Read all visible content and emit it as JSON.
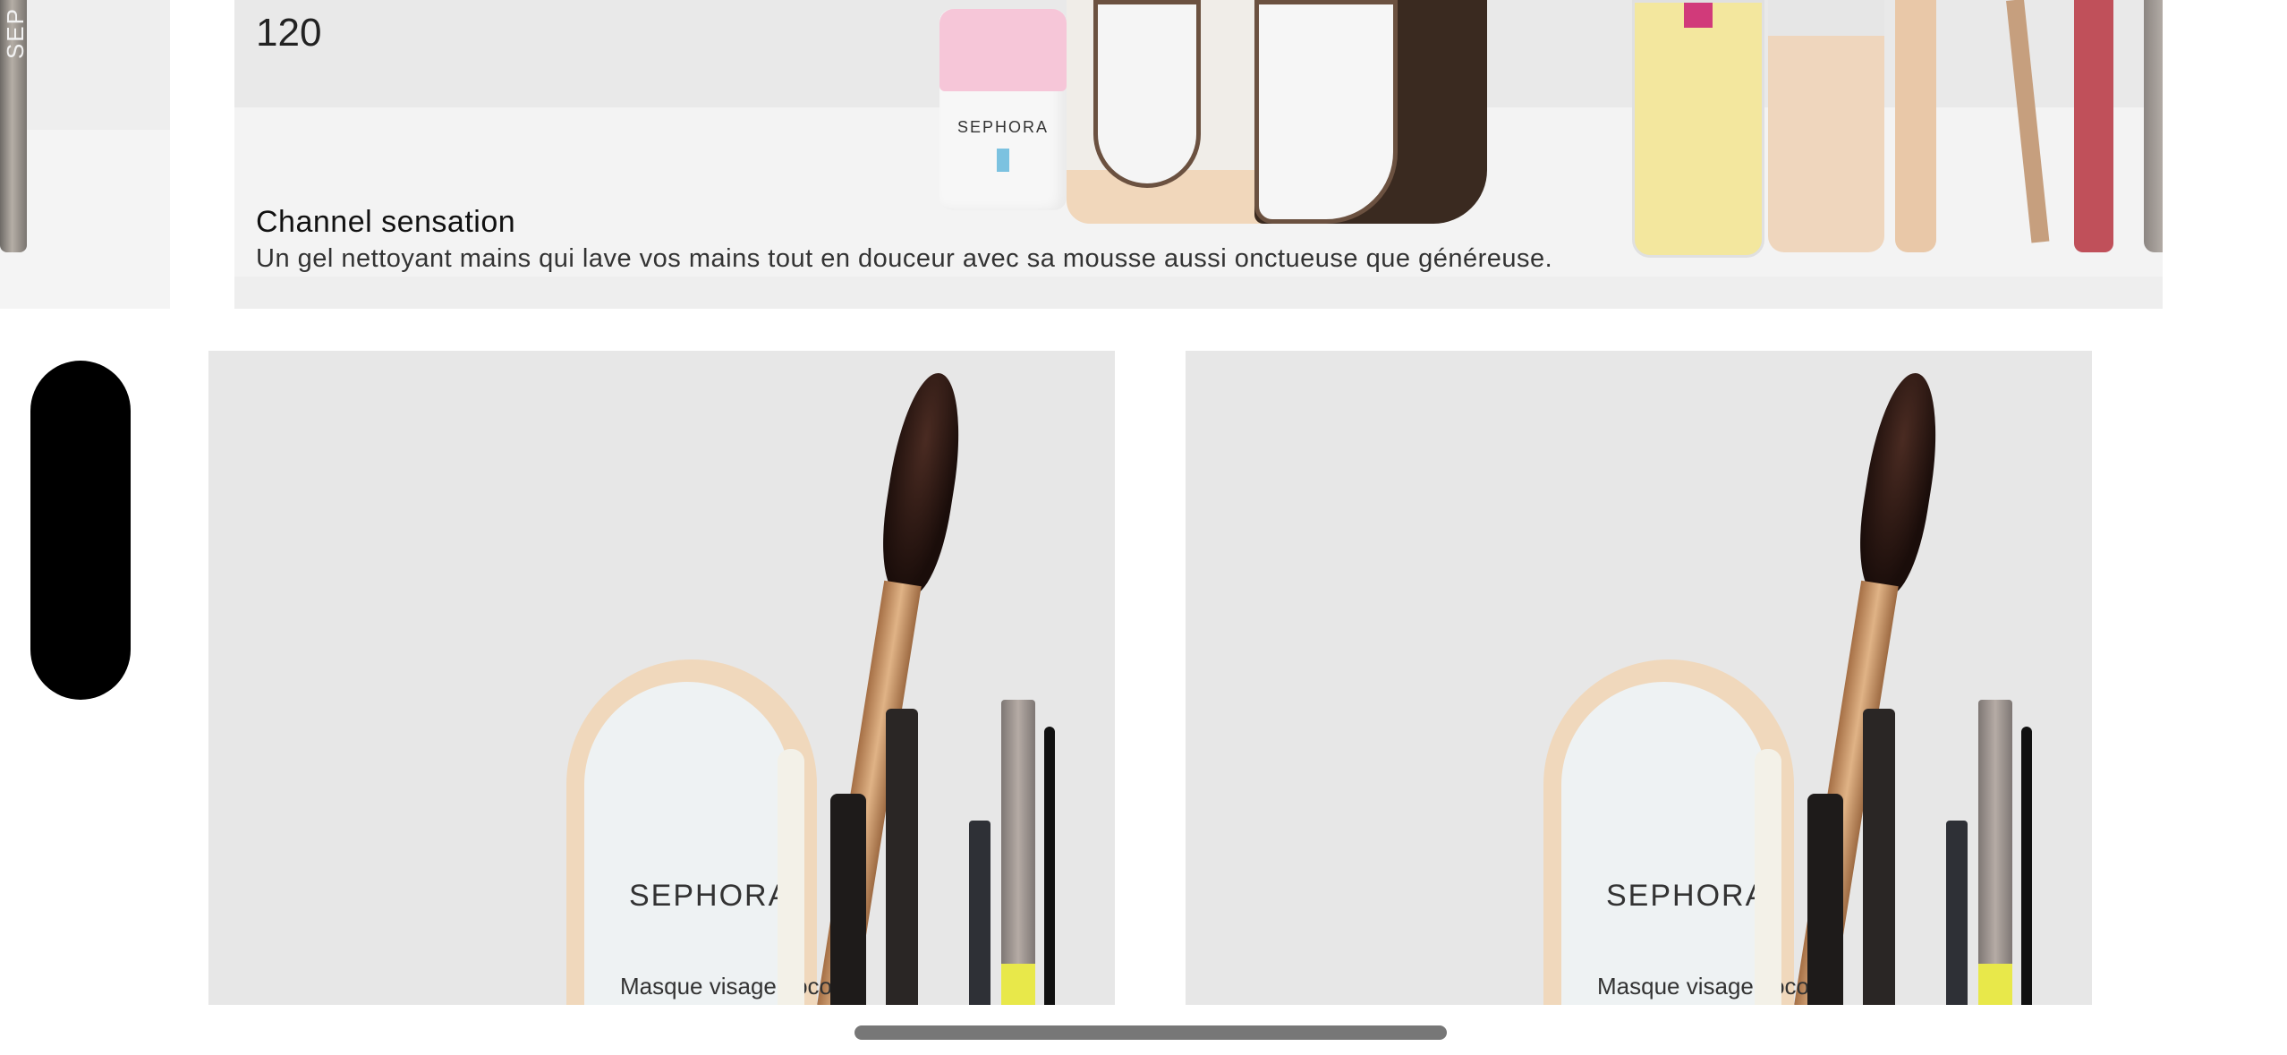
{
  "hero": {
    "badge": "120",
    "title": "Channel sensation",
    "description": "Un gel nettoyant mains qui lave vos mains tout en douceur avec sa mousse aussi onctueuse que généreuse."
  },
  "product_images": {
    "left_card_brand_text": "SEP",
    "jar_label": "SEPHORA",
    "mask_brand": "SEPHORA",
    "mask_subtitle": "Masque visage coco"
  },
  "colors": {
    "background": "#ffffff",
    "side_handle": "#000000",
    "scroll_indicator": "#777777"
  },
  "icons": {
    "side_handle": "pill-handle",
    "scroll_indicator": "home-indicator"
  }
}
